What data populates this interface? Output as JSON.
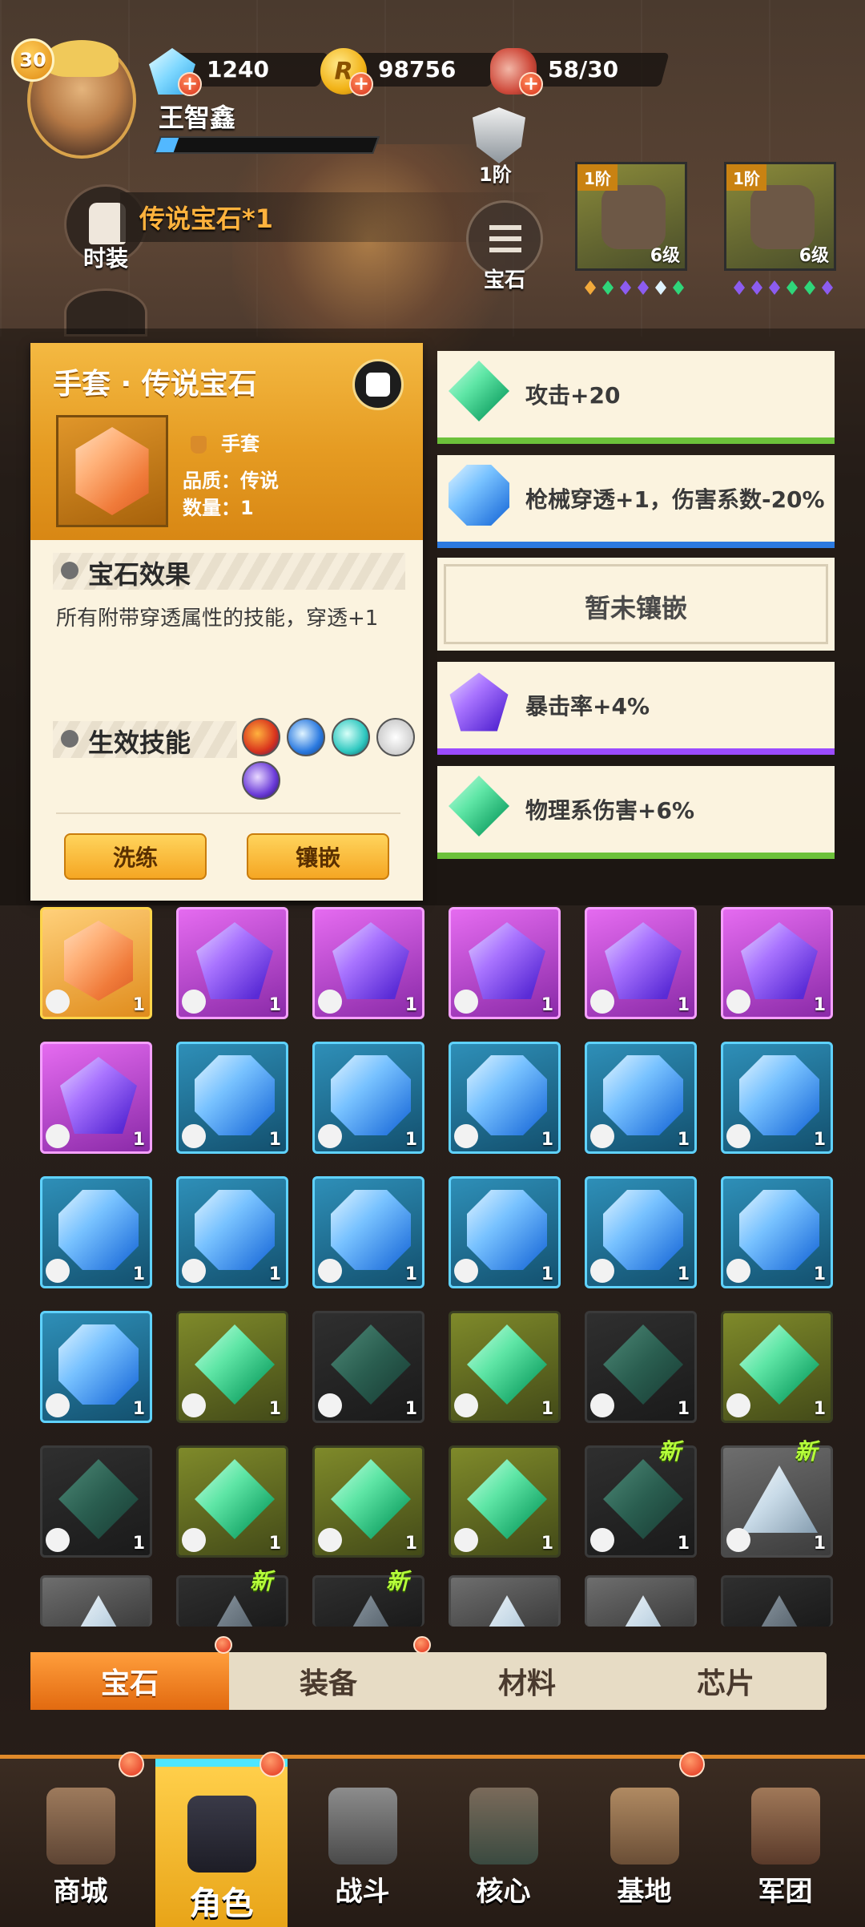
{
  "player": {
    "level": "30",
    "name": "王智鑫",
    "xp_fraction": 0.08
  },
  "resources": [
    {
      "icon": "diamond-icon",
      "value": "1240"
    },
    {
      "icon": "coin-icon",
      "symbol": "R",
      "value": "98756"
    },
    {
      "icon": "meat-stamina-icon",
      "value": "58/30"
    }
  ],
  "rank": {
    "label": "1阶"
  },
  "side_buttons": {
    "costume": "时装",
    "gem": "宝石"
  },
  "hint": "传说宝石*1",
  "equipment": [
    {
      "tier": "1阶",
      "level": "6级",
      "dots": [
        "#f2a93b",
        "#2fd67a",
        "#8c5cf0",
        "#8c5cf0",
        "#dff3ff",
        "#2fd67a"
      ]
    },
    {
      "tier": "1阶",
      "level": "6级",
      "dots": [
        "#8c5cf0",
        "#8c5cf0",
        "#8c5cf0",
        "#2fd67a",
        "#2fd67a",
        "#8c5cf0"
      ]
    }
  ],
  "popup": {
    "title": "手套 · 传说宝石",
    "slot": "手套",
    "quality": "品质：传说",
    "quantity": "数量：1",
    "effect_header": "宝石效果",
    "effect_text": "所有附带穿透属性的技能，穿透+1",
    "skills_header": "生效技能",
    "buttons": {
      "refine": "洗练",
      "inlay": "镶嵌"
    }
  },
  "slots": [
    {
      "gem": "green",
      "shape": "rhombus",
      "text": "攻击+20",
      "stripe": "#6cc13a"
    },
    {
      "gem": "blue",
      "shape": "oct",
      "text": "枪械穿透+1，伤害系数-20%",
      "stripe": "#2b7ae0"
    },
    {
      "gem": "",
      "shape": "",
      "text": "暂未镶嵌",
      "stripe": ""
    },
    {
      "gem": "purple",
      "shape": "pent",
      "text": "暴击率+4%",
      "stripe": "#9b4bff"
    },
    {
      "gem": "green",
      "shape": "rhombus",
      "text": "物理系伤害+6%",
      "stripe": "#6cc13a"
    }
  ],
  "inventory": [
    [
      {
        "frame": "orange",
        "gem": "hex",
        "count": "1",
        "new": false
      },
      {
        "frame": "purple",
        "gem": "purple",
        "count": "1",
        "new": false
      },
      {
        "frame": "purple",
        "gem": "purple",
        "count": "1",
        "new": false
      },
      {
        "frame": "purple",
        "gem": "purple",
        "count": "1",
        "new": false
      },
      {
        "frame": "purple",
        "gem": "purple",
        "count": "1",
        "new": false
      },
      {
        "frame": "purple",
        "gem": "purple",
        "count": "1",
        "new": false
      }
    ],
    [
      {
        "frame": "purple",
        "gem": "purple",
        "count": "1",
        "new": false
      },
      {
        "frame": "blue",
        "gem": "blue",
        "count": "1",
        "new": false
      },
      {
        "frame": "blue",
        "gem": "blue",
        "count": "1",
        "new": false
      },
      {
        "frame": "blue",
        "gem": "blue",
        "count": "1",
        "new": false
      },
      {
        "frame": "blue",
        "gem": "blue",
        "count": "1",
        "new": false
      },
      {
        "frame": "blue",
        "gem": "blue",
        "count": "1",
        "new": false
      }
    ],
    [
      {
        "frame": "blue",
        "gem": "blue",
        "count": "1",
        "new": false
      },
      {
        "frame": "blue",
        "gem": "blue",
        "count": "1",
        "new": false
      },
      {
        "frame": "blue",
        "gem": "blue",
        "count": "1",
        "new": false
      },
      {
        "frame": "blue",
        "gem": "blue",
        "count": "1",
        "new": false
      },
      {
        "frame": "blue",
        "gem": "blue",
        "count": "1",
        "new": false
      },
      {
        "frame": "blue",
        "gem": "blue",
        "count": "1",
        "new": false
      }
    ],
    [
      {
        "frame": "blue",
        "gem": "blue",
        "count": "1",
        "new": false
      },
      {
        "frame": "green",
        "gem": "green",
        "count": "1",
        "new": false
      },
      {
        "frame": "dark",
        "gem": "dgreen",
        "count": "1",
        "new": false
      },
      {
        "frame": "green",
        "gem": "green",
        "count": "1",
        "new": false
      },
      {
        "frame": "dark",
        "gem": "dgreen",
        "count": "1",
        "new": false
      },
      {
        "frame": "green",
        "gem": "green",
        "count": "1",
        "new": false
      }
    ],
    [
      {
        "frame": "dark",
        "gem": "dgreen",
        "count": "1",
        "new": false
      },
      {
        "frame": "green",
        "gem": "green",
        "count": "1",
        "new": false
      },
      {
        "frame": "green",
        "gem": "green",
        "count": "1",
        "new": false
      },
      {
        "frame": "green",
        "gem": "green",
        "count": "1",
        "new": false
      },
      {
        "frame": "dark",
        "gem": "dgreen",
        "count": "1",
        "new": true
      },
      {
        "frame": "grey",
        "gem": "silver",
        "count": "1",
        "new": true
      }
    ],
    [
      {
        "frame": "grey",
        "gem": "silver",
        "count": "",
        "new": false
      },
      {
        "frame": "dark",
        "gem": "dsilver",
        "count": "",
        "new": true
      },
      {
        "frame": "dark",
        "gem": "dsilver",
        "count": "",
        "new": true
      },
      {
        "frame": "grey",
        "gem": "silver",
        "count": "",
        "new": false
      },
      {
        "frame": "grey",
        "gem": "silver",
        "count": "",
        "new": false
      },
      {
        "frame": "dark",
        "gem": "dsilver",
        "count": "",
        "new": false
      }
    ]
  ],
  "new_label": "新",
  "tabs": [
    {
      "label": "宝石",
      "active": true,
      "dot": true
    },
    {
      "label": "装备",
      "active": false,
      "dot": true
    },
    {
      "label": "材料",
      "active": false,
      "dot": false
    },
    {
      "label": "芯片",
      "active": false,
      "dot": false
    }
  ],
  "nav": [
    {
      "label": "商城",
      "icon": "shop-icon",
      "active": false,
      "dot": true
    },
    {
      "label": "角色",
      "icon": "character-icon",
      "active": true,
      "dot": true
    },
    {
      "label": "战斗",
      "icon": "battle-icon",
      "active": false,
      "dot": false
    },
    {
      "label": "核心",
      "icon": "core-icon",
      "active": false,
      "dot": false
    },
    {
      "label": "基地",
      "icon": "base-icon",
      "active": false,
      "dot": true
    },
    {
      "label": "军团",
      "icon": "legion-icon",
      "active": false,
      "dot": false
    }
  ]
}
